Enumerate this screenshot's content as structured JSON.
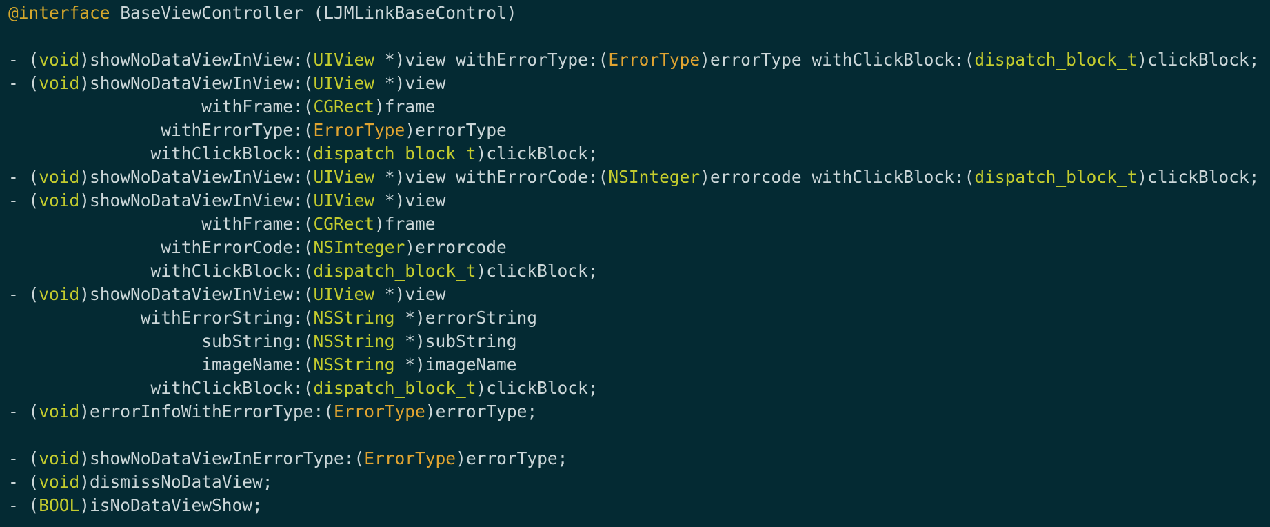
{
  "editor": {
    "colors": {
      "background": "#042a33",
      "plain": "#cbd6d8",
      "keyword": "#d4a72c",
      "type": "#c4cc2e",
      "enum_type": "#e1a431"
    },
    "lines": [
      [
        {
          "t": "@interface",
          "c": "keyword"
        },
        {
          "t": " BaseViewController (LJMLinkBaseControl)",
          "c": "plain"
        }
      ],
      [],
      [
        {
          "t": "- (",
          "c": "plain"
        },
        {
          "t": "void",
          "c": "type"
        },
        {
          "t": ")showNoDataViewInView:(",
          "c": "plain"
        },
        {
          "t": "UIView",
          "c": "type"
        },
        {
          "t": " *)view withErrorType:(",
          "c": "plain"
        },
        {
          "t": "ErrorType",
          "c": "errtype"
        },
        {
          "t": ")errorType withClickBlock:(",
          "c": "plain"
        },
        {
          "t": "dispatch_block_t",
          "c": "type"
        },
        {
          "t": ")clickBlock;",
          "c": "plain"
        }
      ],
      [
        {
          "t": "- (",
          "c": "plain"
        },
        {
          "t": "void",
          "c": "type"
        },
        {
          "t": ")showNoDataViewInView:(",
          "c": "plain"
        },
        {
          "t": "UIView",
          "c": "type"
        },
        {
          "t": " *)view",
          "c": "plain"
        }
      ],
      [
        {
          "t": "                   withFrame:(",
          "c": "plain"
        },
        {
          "t": "CGRect",
          "c": "type"
        },
        {
          "t": ")frame",
          "c": "plain"
        }
      ],
      [
        {
          "t": "               withErrorType:(",
          "c": "plain"
        },
        {
          "t": "ErrorType",
          "c": "errtype"
        },
        {
          "t": ")errorType",
          "c": "plain"
        }
      ],
      [
        {
          "t": "              withClickBlock:(",
          "c": "plain"
        },
        {
          "t": "dispatch_block_t",
          "c": "type"
        },
        {
          "t": ")clickBlock;",
          "c": "plain"
        }
      ],
      [
        {
          "t": "- (",
          "c": "plain"
        },
        {
          "t": "void",
          "c": "type"
        },
        {
          "t": ")showNoDataViewInView:(",
          "c": "plain"
        },
        {
          "t": "UIView",
          "c": "type"
        },
        {
          "t": " *)view withErrorCode:(",
          "c": "plain"
        },
        {
          "t": "NSInteger",
          "c": "type"
        },
        {
          "t": ")errorcode withClickBlock:(",
          "c": "plain"
        },
        {
          "t": "dispatch_block_t",
          "c": "type"
        },
        {
          "t": ")clickBlock;",
          "c": "plain"
        }
      ],
      [
        {
          "t": "- (",
          "c": "plain"
        },
        {
          "t": "void",
          "c": "type"
        },
        {
          "t": ")showNoDataViewInView:(",
          "c": "plain"
        },
        {
          "t": "UIView",
          "c": "type"
        },
        {
          "t": " *)view",
          "c": "plain"
        }
      ],
      [
        {
          "t": "                   withFrame:(",
          "c": "plain"
        },
        {
          "t": "CGRect",
          "c": "type"
        },
        {
          "t": ")frame",
          "c": "plain"
        }
      ],
      [
        {
          "t": "               withErrorCode:(",
          "c": "plain"
        },
        {
          "t": "NSInteger",
          "c": "type"
        },
        {
          "t": ")errorcode",
          "c": "plain"
        }
      ],
      [
        {
          "t": "              withClickBlock:(",
          "c": "plain"
        },
        {
          "t": "dispatch_block_t",
          "c": "type"
        },
        {
          "t": ")clickBlock;",
          "c": "plain"
        }
      ],
      [
        {
          "t": "- (",
          "c": "plain"
        },
        {
          "t": "void",
          "c": "type"
        },
        {
          "t": ")showNoDataViewInView:(",
          "c": "plain"
        },
        {
          "t": "UIView",
          "c": "type"
        },
        {
          "t": " *)view",
          "c": "plain"
        }
      ],
      [
        {
          "t": "             withErrorString:(",
          "c": "plain"
        },
        {
          "t": "NSString",
          "c": "type"
        },
        {
          "t": " *)errorString",
          "c": "plain"
        }
      ],
      [
        {
          "t": "                   subString:(",
          "c": "plain"
        },
        {
          "t": "NSString",
          "c": "type"
        },
        {
          "t": " *)subString",
          "c": "plain"
        }
      ],
      [
        {
          "t": "                   imageName:(",
          "c": "plain"
        },
        {
          "t": "NSString",
          "c": "type"
        },
        {
          "t": " *)imageName",
          "c": "plain"
        }
      ],
      [
        {
          "t": "              withClickBlock:(",
          "c": "plain"
        },
        {
          "t": "dispatch_block_t",
          "c": "type"
        },
        {
          "t": ")clickBlock;",
          "c": "plain"
        }
      ],
      [
        {
          "t": "- (",
          "c": "plain"
        },
        {
          "t": "void",
          "c": "type"
        },
        {
          "t": ")errorInfoWithErrorType:(",
          "c": "plain"
        },
        {
          "t": "ErrorType",
          "c": "errtype"
        },
        {
          "t": ")errorType;",
          "c": "plain"
        }
      ],
      [],
      [
        {
          "t": "- (",
          "c": "plain"
        },
        {
          "t": "void",
          "c": "type"
        },
        {
          "t": ")showNoDataViewInErrorType:(",
          "c": "plain"
        },
        {
          "t": "ErrorType",
          "c": "errtype"
        },
        {
          "t": ")errorType;",
          "c": "plain"
        }
      ],
      [
        {
          "t": "- (",
          "c": "plain"
        },
        {
          "t": "void",
          "c": "type"
        },
        {
          "t": ")dismissNoDataView;",
          "c": "plain"
        }
      ],
      [
        {
          "t": "- (",
          "c": "plain"
        },
        {
          "t": "BOOL",
          "c": "type"
        },
        {
          "t": ")isNoDataViewShow;",
          "c": "plain"
        }
      ]
    ]
  }
}
